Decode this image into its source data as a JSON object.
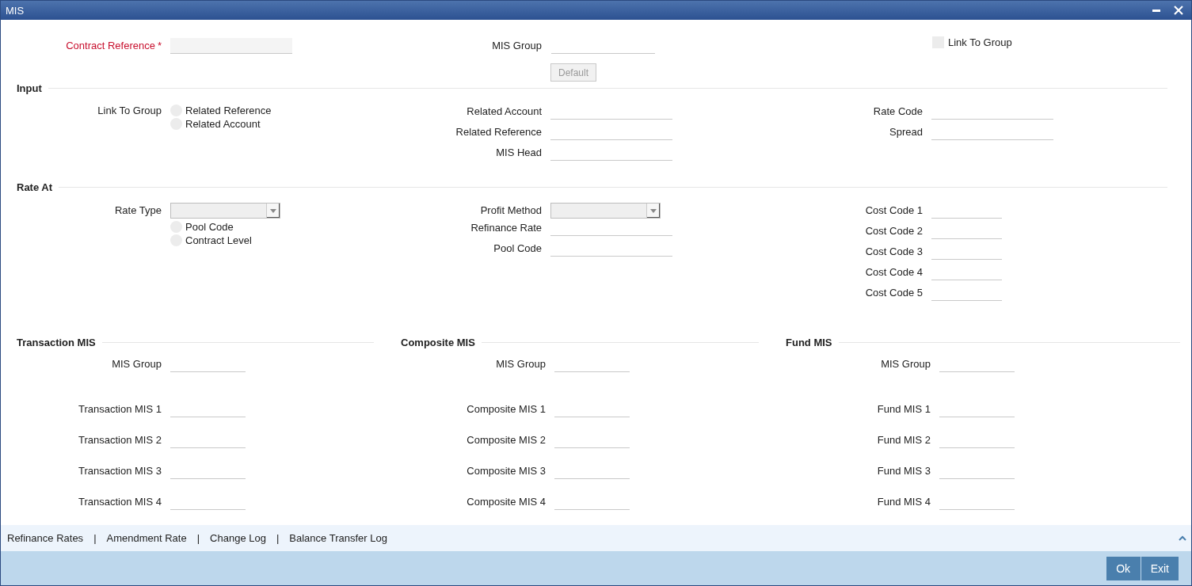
{
  "window": {
    "title": "MIS"
  },
  "header": {
    "contract_reference": {
      "label": "Contract Reference",
      "required": "*"
    },
    "mis_group": {
      "label": "MIS Group"
    },
    "default_button": {
      "label": "Default",
      "disabled": true
    },
    "link_to_group": {
      "label": "Link To Group",
      "checked": false
    }
  },
  "sections": [
    {
      "title": "Input",
      "columns": [
        [
          {
            "kind": "radio-group",
            "label": "Link To Group",
            "options": [
              {
                "label": "Related Reference",
                "selected": false
              },
              {
                "label": "Related Account",
                "selected": false
              }
            ]
          }
        ],
        [
          {
            "kind": "text",
            "label": "Related Account"
          },
          {
            "kind": "text",
            "label": "Related Reference"
          },
          {
            "kind": "text",
            "label": "MIS Head"
          }
        ],
        [
          {
            "kind": "text",
            "label": "Rate Code"
          },
          {
            "kind": "text",
            "label": "Spread"
          }
        ]
      ]
    },
    {
      "title": "Rate At",
      "columns": [
        [
          {
            "kind": "select",
            "label": "Rate Type"
          },
          {
            "kind": "radio-group",
            "options": [
              {
                "label": "Pool Code",
                "selected": false
              },
              {
                "label": "Contract Level",
                "selected": false
              }
            ]
          }
        ],
        [
          {
            "kind": "select",
            "label": "Profit Method"
          },
          {
            "kind": "text",
            "label": "Refinance Rate"
          },
          {
            "kind": "text",
            "label": "Pool Code"
          }
        ],
        [
          {
            "kind": "text",
            "label": "Cost Code 1"
          },
          {
            "kind": "text",
            "label": "Cost Code 2"
          },
          {
            "kind": "text",
            "label": "Cost Code 3"
          },
          {
            "kind": "text",
            "label": "Cost Code 4"
          },
          {
            "kind": "text",
            "label": "Cost Code 5"
          }
        ]
      ]
    }
  ],
  "mis_groups": [
    {
      "title": "Transaction MIS",
      "fields": [
        "MIS Group",
        "Transaction MIS 1",
        "Transaction MIS 2",
        "Transaction MIS 3",
        "Transaction MIS 4"
      ]
    },
    {
      "title": "Composite MIS",
      "fields": [
        "MIS Group",
        "Composite MIS 1",
        "Composite MIS 2",
        "Composite MIS 3",
        "Composite MIS 4"
      ]
    },
    {
      "title": "Fund MIS",
      "fields": [
        "MIS Group",
        "Fund MIS 1",
        "Fund MIS 2",
        "Fund MIS 3",
        "Fund MIS 4"
      ]
    }
  ],
  "footer_links": {
    "links": [
      "Refinance Rates",
      "Amendment Rate",
      "Change Log",
      "Balance Transfer Log"
    ],
    "separator": "|"
  },
  "buttons": [
    "Ok",
    "Exit"
  ]
}
